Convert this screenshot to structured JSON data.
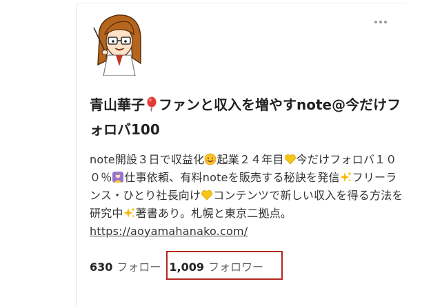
{
  "profile": {
    "name": "青山華子",
    "title_rest": "ファンと収入を増やすnote@今だけフォロバ100",
    "bio_parts": {
      "p1": "note開設３日で収益化",
      "p2": "起業２４年目",
      "p3": "今だけフォロバ１００％",
      "p4": "仕事依頼、有料noteを販売する秘訣を発信",
      "p5": "フリーランス・ひとり社長向け",
      "p6": "コンテンツで新しい収入を得る方法を研究中",
      "p7": "著書あり。札幌と東京二拠点。",
      "link": "https://aoyamahanako.com/"
    },
    "icons": {
      "title": "balloon-icon",
      "smile": "smiling-face-icon",
      "heart": "yellow-heart-icon",
      "person": "person-icon",
      "sparkles": "sparkles-icon"
    }
  },
  "stats": {
    "following_count": "630",
    "following_label": "フォロー",
    "followers_count": "1,009",
    "followers_label": "フォロワー"
  },
  "colors": {
    "highlight": "#b3261e",
    "heart": "#f5c518"
  }
}
